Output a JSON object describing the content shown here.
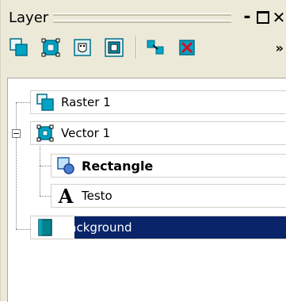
{
  "panel": {
    "title": "Layer",
    "more_label": "»",
    "toolbar_icons": [
      "new-raster-layer-icon",
      "new-vector-layer-icon",
      "new-mask-layer-icon",
      "new-adjustment-layer-icon",
      "duplicate-layer-icon",
      "delete-layer-icon"
    ]
  },
  "layers": [
    {
      "label": "Raster 1",
      "icon": "raster-layer-icon",
      "level": 0
    },
    {
      "label": "Vector 1",
      "icon": "vector-layer-icon",
      "level": 0,
      "expanded": true
    },
    {
      "label": "Rectangle",
      "icon": "rectangle-shape-icon",
      "level": 1
    },
    {
      "label": "Testo",
      "icon": "text-object-icon",
      "level": 1
    },
    {
      "label": "Background",
      "icon": "background-layer-icon",
      "level": 0,
      "selected": true
    }
  ],
  "colors": {
    "panel_bg": "#ece9d8",
    "selection": "#0a246a",
    "icon_cyan": "#00a3c4"
  }
}
